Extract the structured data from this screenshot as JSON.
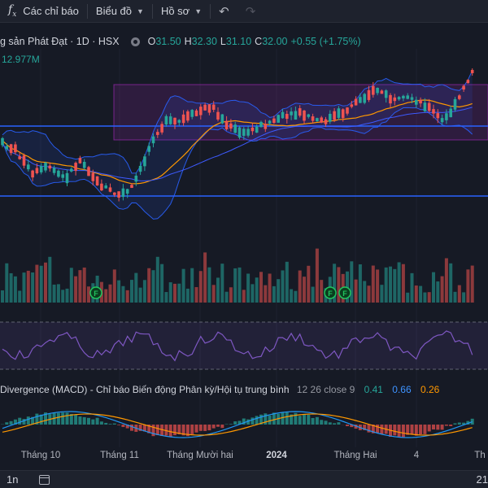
{
  "toolbar": {
    "fx_symbol": "f",
    "fx_sub": "x",
    "indicators_label": "Các chỉ báo",
    "chart_type_label": "Biểu đồ",
    "profile_label": "Hồ sơ"
  },
  "legend": {
    "symbol": "g sản Phát Đạt · 1D · HSX",
    "open_k": "O",
    "open_v": "31.50",
    "high_k": "H",
    "high_v": "32.30",
    "low_k": "L",
    "low_v": "31.10",
    "close_k": "C",
    "close_v": "32.00",
    "change": "+0.55 (+1.75%)",
    "volume": "12.977M"
  },
  "macd": {
    "title": "Divergence (MACD) - Chỉ báo Biến động Phân kỳ/Hội tụ trung bình",
    "params": "12 26 close 9",
    "v1": "0.41",
    "v2": "0.66",
    "v3": "0.26"
  },
  "timeaxis": {
    "t1": "Tháng 10",
    "t2": "Tháng 11",
    "t3": "Tháng Mười hai",
    "t4": "2024",
    "t5": "Tháng Hai",
    "t6": "4",
    "t7": "Th"
  },
  "bottom": {
    "timeframe": "1n",
    "right_text": "21"
  },
  "markers": {
    "f": "F"
  },
  "colors": {
    "up": "#26a69a",
    "down": "#ef5350",
    "bb": "#2962ff",
    "ma": "#ff9800",
    "rsi": "#7e57c2",
    "zone": "#9c27b0",
    "hline": "#2962ff"
  }
}
